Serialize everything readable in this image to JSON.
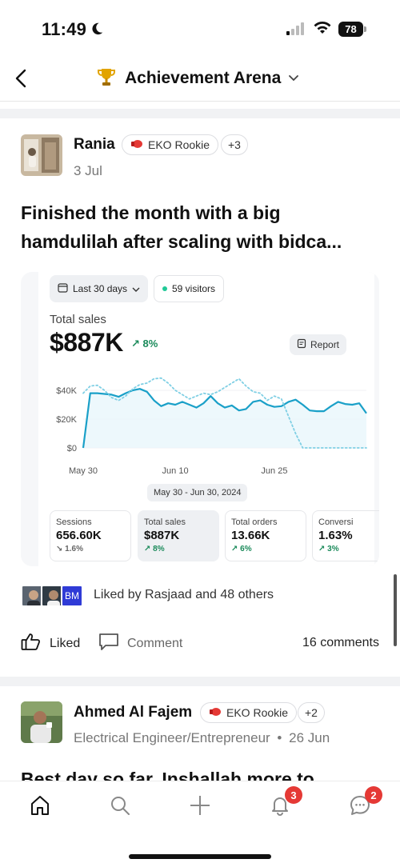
{
  "status_bar": {
    "time": "11:49",
    "battery": "78"
  },
  "header": {
    "title": "Achievement Arena"
  },
  "post1": {
    "author": "Rania",
    "badge": "EKO Rookie",
    "extra_badges": "+3",
    "date": "3 Jul",
    "title_line1": "Finished the month with a big",
    "title_line2": "hamdulilah after scaling with bidca...",
    "dashboard": {
      "range_dropdown": "Last 30 days",
      "visitors": "59 visitors",
      "total_sales_label": "Total sales",
      "total_sales_value": "$887K",
      "total_sales_delta": "8%",
      "report_label": "Report",
      "range_caption": "May 30 - Jun 30, 2024",
      "kpis": [
        {
          "label": "Sessions",
          "value": "656.60K",
          "delta": "1.6%"
        },
        {
          "label": "Total sales",
          "value": "$887K",
          "delta": "8%"
        },
        {
          "label": "Total orders",
          "value": "13.66K",
          "delta": "6%"
        },
        {
          "label": "Conversi",
          "value": "1.63%",
          "delta": "3%"
        }
      ]
    },
    "liker_initials": "BM",
    "liked_text": "Liked by Rasjaad and 48 others",
    "like_label": "Liked",
    "comment_label": "Comment",
    "comments_count": "16 comments"
  },
  "post2": {
    "author": "Ahmed Al Fajem",
    "badge": "EKO Rookie",
    "extra_badges": "+2",
    "subtitle": "Electrical Engineer/Entrepreneur",
    "date": "26 Jun",
    "title_partial": "Best day so far, Inshallah more to"
  },
  "bottom_nav": {
    "notifications_badge": "3",
    "messages_badge": "2"
  },
  "chart_data": {
    "type": "line",
    "y_ticks": [
      "$0",
      "$20K",
      "$40K"
    ],
    "x_ticks": [
      "May 30",
      "Jun 10",
      "Jun 25"
    ],
    "ylim": [
      0,
      50000
    ],
    "series": [
      {
        "style": "solid",
        "values": [
          0,
          38000,
          38000,
          37500,
          37000,
          35500,
          38000,
          40000,
          41000,
          39000,
          33000,
          29000,
          31000,
          30000,
          32000,
          30000,
          28000,
          31000,
          36000,
          31000,
          28000,
          29500,
          26000,
          27000,
          32000,
          33000,
          30000,
          28500,
          29000,
          32000,
          33500,
          30000,
          26000,
          25500,
          25500,
          29000,
          32000,
          30500,
          30000,
          31000,
          24000
        ]
      },
      {
        "style": "dotted",
        "values": [
          38000,
          43000,
          43500,
          40000,
          35000,
          33000,
          36000,
          41000,
          44000,
          45000,
          48000,
          48500,
          45000,
          40000,
          37000,
          34000,
          36000,
          38000,
          37000,
          39000,
          42000,
          45000,
          48000,
          43000,
          39000,
          38000,
          33000,
          36000,
          34000,
          22000,
          10000,
          0,
          0,
          0,
          0,
          0,
          0,
          0,
          0,
          0,
          0
        ]
      }
    ]
  }
}
